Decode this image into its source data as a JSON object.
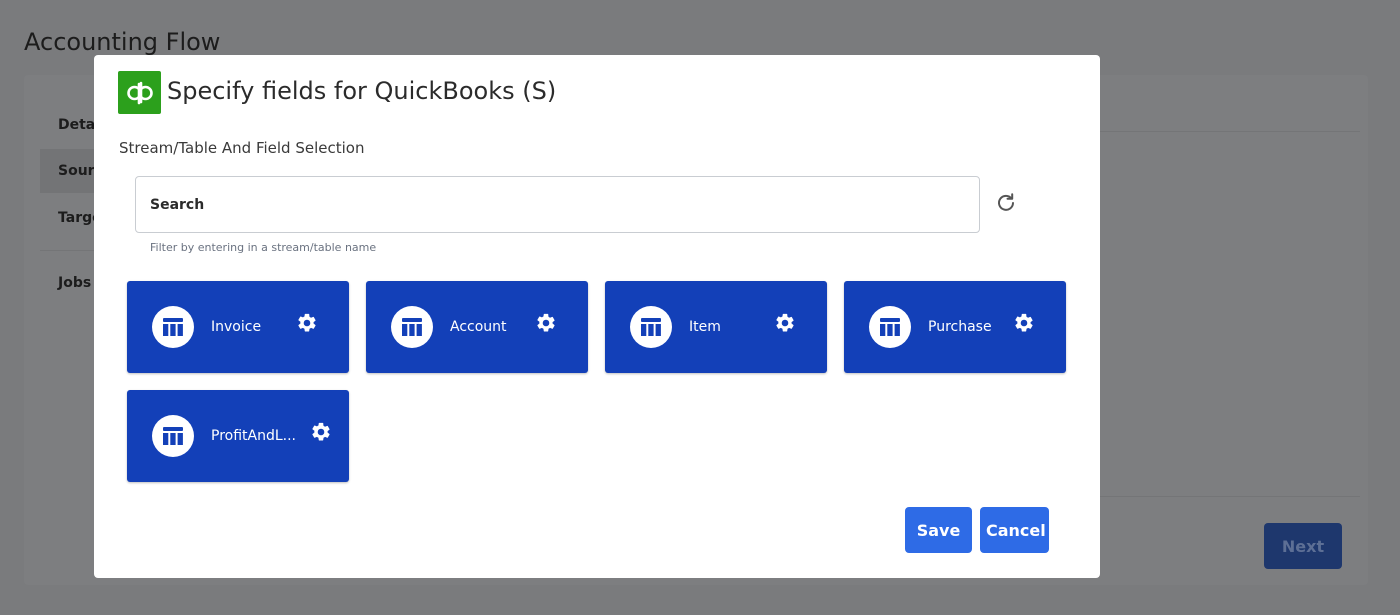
{
  "background": {
    "page_title": "Accounting Flow",
    "sidebar": [
      "Detai",
      "Sourc",
      "Targe",
      "Jobs"
    ],
    "next_label": "Next"
  },
  "modal": {
    "logo_icon": "quickbooks-logo-icon",
    "title": "Specify fields for QuickBooks (S)",
    "section_label": "Stream/Table And Field Selection",
    "search": {
      "placeholder": "Search",
      "value": "",
      "helper": "Filter by entering in a stream/table name"
    },
    "refresh_icon": "refresh-icon",
    "streams": [
      {
        "name": "Invoice",
        "icon": "table-icon",
        "settings_icon": "gear-icon"
      },
      {
        "name": "Account",
        "icon": "table-icon",
        "settings_icon": "gear-icon"
      },
      {
        "name": "Item",
        "icon": "table-icon",
        "settings_icon": "gear-icon"
      },
      {
        "name": "Purchase",
        "icon": "table-icon",
        "settings_icon": "gear-icon"
      },
      {
        "name": "ProfitAndL...",
        "icon": "table-icon",
        "settings_icon": "gear-icon"
      }
    ],
    "save_label": "Save",
    "cancel_label": "Cancel"
  },
  "colors": {
    "card_blue": "#1340b8",
    "button_blue": "#2e6be6",
    "quickbooks_green": "#2ca01c",
    "overlay_gray": "#7a7b7d"
  }
}
